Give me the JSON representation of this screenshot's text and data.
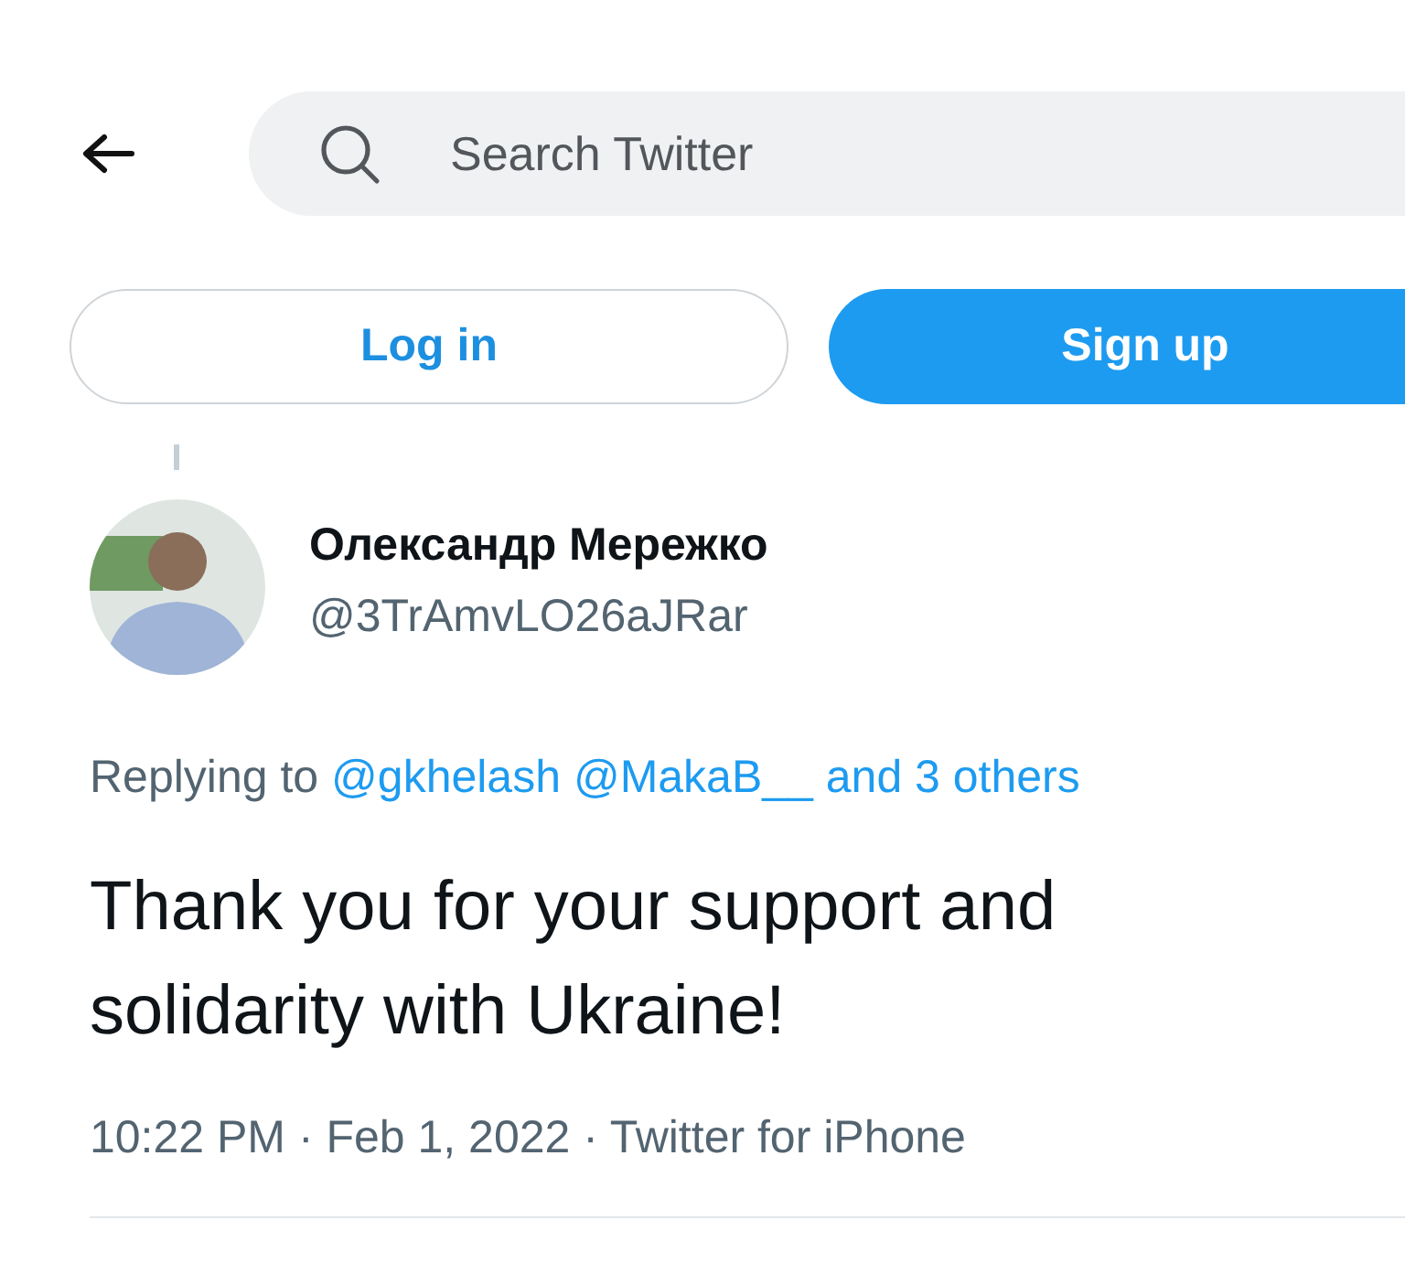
{
  "header": {
    "search": {
      "placeholder": "Search Twitter"
    }
  },
  "auth_buttons": [
    {
      "label": "Log in",
      "kind": "outline"
    },
    {
      "label": "Sign up",
      "kind": "filled"
    }
  ],
  "tweet": {
    "author": {
      "name": "Олександр Мережко",
      "handle": "@3TrAmvLO26aJRar"
    },
    "reply_context": {
      "prefix": "Replying to",
      "links": [
        "@gkhelash",
        "@MakaB__",
        "and 3 others"
      ]
    },
    "text": "Thank you for your support and solidarity with Ukraine!",
    "meta": "10:22 PM · Feb 1, 2022 · Twitter for iPhone"
  }
}
